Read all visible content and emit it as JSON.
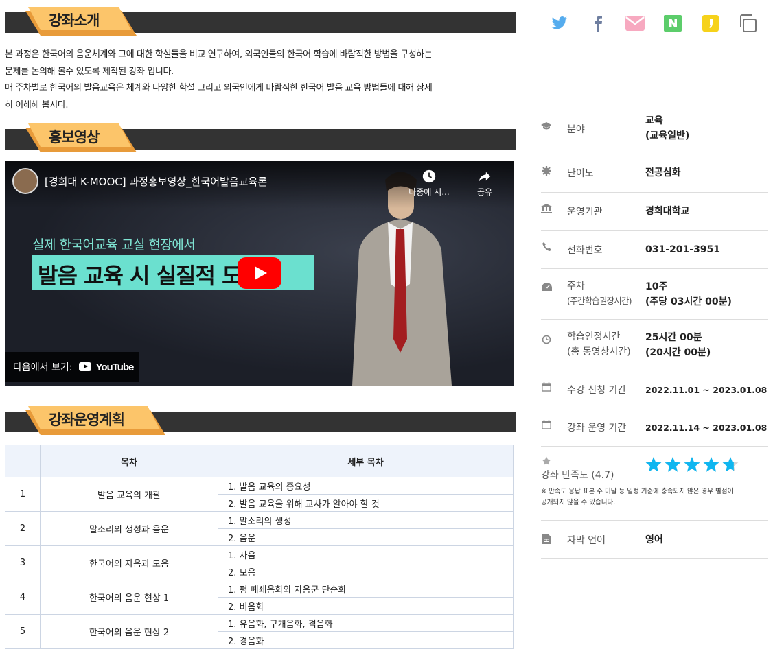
{
  "sections": {
    "intro_title": "강좌소개",
    "video_title": "홍보영상",
    "plan_title": "강좌운영계획"
  },
  "intro": {
    "lines": [
      "본 과정은 한국어의 음운체계와 그에 대한 학설들을 비교 연구하여, 외국인들의 한국어 학습에 바람직한 방법을 구성하는",
      "문제를 논의해 볼수 있도록 제작된 강좌 입니다.",
      "매 주차별로 한국어의 발음교육은 체계와 다양한 학설 그리고 외국인에게 바람직한 한국어 발음 교육 방법들에 대해 상세",
      "히 이해해 봅시다."
    ]
  },
  "video": {
    "title": "[경희대 K-MOOC] 과정홍보영상_한국어발음교육론",
    "later_label": "나중에 시...",
    "share_label": "공유",
    "subtitle": "실제 한국어교육 교실 현장에서",
    "headline": "발음 교육 시 실질적 도움",
    "watch_label": "다음에서 보기:",
    "youtube_label": "YouTube"
  },
  "plan": {
    "headers": [
      "",
      "목차",
      "세부 목차"
    ],
    "rows": [
      {
        "num": "1",
        "title": "발음 교육의 개괄",
        "subs": [
          "1. 발음 교육의 중요성",
          "2. 발음 교육을 위해 교사가 알아야 할 것"
        ]
      },
      {
        "num": "2",
        "title": "말소리의 생성과 음운",
        "subs": [
          "1. 말소리의 생성",
          "2. 음운"
        ]
      },
      {
        "num": "3",
        "title": "한국어의 자음과 모음",
        "subs": [
          "1. 자음",
          "2. 모음"
        ]
      },
      {
        "num": "4",
        "title": "한국어의 음운 현상 1",
        "subs": [
          "1. 평 폐쇄음화와 자음군 단순화",
          "2. 비음화"
        ]
      },
      {
        "num": "5",
        "title": "한국어의 음운 현상 2",
        "subs": [
          "1. 유음화, 구개음화, 격음화",
          "2. 경음화"
        ]
      }
    ]
  },
  "share_icons": [
    "twitter-icon",
    "facebook-icon",
    "mail-icon",
    "naver-icon",
    "kakao-story-icon",
    "copy-icon"
  ],
  "colors": {
    "accent": "#f5a623",
    "twitter": "#55acee",
    "facebook": "#6f7fa0",
    "mail": "#f7a9c0",
    "naver": "#5ccd6b",
    "kakao": "#f6d21b",
    "star": "#0fb6f0"
  },
  "info": {
    "field_label": "분야",
    "field_value1": "교육",
    "field_value2": "(교육일반)",
    "level_label": "난이도",
    "level_value": "전공심화",
    "org_label": "운영기관",
    "org_value": "경희대학교",
    "phone_label": "전화번호",
    "phone_value": "031-201-3951",
    "weeks_label1": "주차",
    "weeks_label2": "(주간학습권장시간)",
    "weeks_value1": "10주",
    "weeks_value2": "(주당 03시간 00분)",
    "hours_label1": "학습인정시간",
    "hours_label2": "(총 동영상시간)",
    "hours_value1": "25시간 00분",
    "hours_value2": "(20시간 00분)",
    "enroll_label": "수강 신청 기간",
    "enroll_value": "2022.11.01 ~ 2023.01.08",
    "run_label": "강좌 운영 기간",
    "run_value": "2022.11.14 ~ 2023.01.08",
    "rating_label": "강좌 만족도 (4.7)",
    "rating": 4.7,
    "rating_note1": "※ 만족도 응답 표본 수 미달 등 일정 기준에 충족되지 않은 경우 별점이",
    "rating_note2": "공개되지 않을 수 있습니다.",
    "caption_label": "자막 언어",
    "caption_value": "영어"
  }
}
